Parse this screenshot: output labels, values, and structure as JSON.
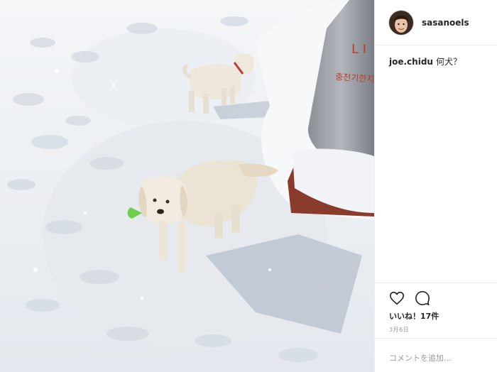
{
  "post": {
    "photo": {
      "subject": "two white puppies in snow",
      "sign_text_1": "L I",
      "sign_text_2": "충전기한지"
    },
    "header": {
      "username": "sasanoels"
    },
    "comment": {
      "username": "joe.chidu",
      "text": "何犬？"
    },
    "actions": {
      "like_icon": "heart-icon",
      "comment_icon": "comment-icon",
      "likes_text": "いいね！17件",
      "date_text": "3月6日"
    },
    "add_comment": {
      "placeholder": "コメントを追加..."
    }
  },
  "colors": {
    "accent_red": "#d1322a",
    "text": "#262626",
    "muted": "#999999",
    "border": "#efefef"
  }
}
